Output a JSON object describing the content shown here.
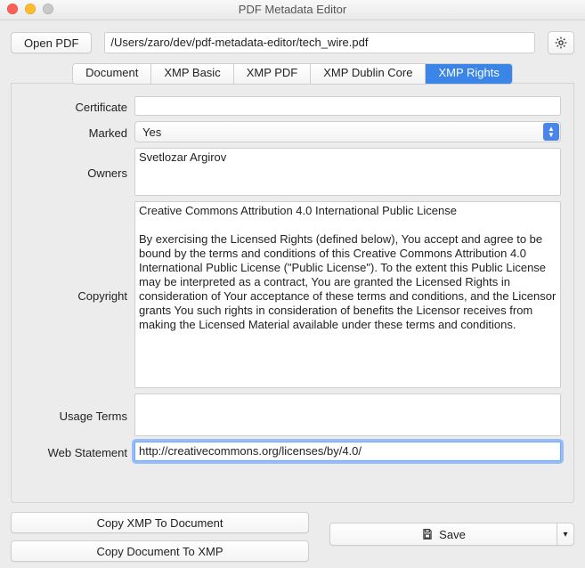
{
  "window": {
    "title": "PDF Metadata Editor"
  },
  "toolbar": {
    "open_label": "Open PDF",
    "file_path": "/Users/zaro/dev/pdf-metadata-editor/tech_wire.pdf"
  },
  "tabs": {
    "items": [
      {
        "label": "Document",
        "active": false
      },
      {
        "label": "XMP Basic",
        "active": false
      },
      {
        "label": "XMP PDF",
        "active": false
      },
      {
        "label": "XMP Dublin Core",
        "active": false
      },
      {
        "label": "XMP Rights",
        "active": true
      }
    ]
  },
  "form": {
    "labels": {
      "certificate": "Certificate",
      "marked": "Marked",
      "owners": "Owners",
      "copyright": "Copyright",
      "usage_terms": "Usage Terms",
      "web_statement": "Web Statement"
    },
    "values": {
      "certificate": "",
      "marked": "Yes",
      "owners": "Svetlozar Argirov",
      "copyright": "Creative Commons Attribution 4.0 International Public License\n\nBy exercising the Licensed Rights (defined below), You accept and agree to be bound by the terms and conditions of this Creative Commons Attribution 4.0 International Public License (\"Public License\"). To the extent this Public License may be interpreted as a contract, You are granted the Licensed Rights in consideration of Your acceptance of these terms and conditions, and the Licensor grants You such rights in consideration of benefits the Licensor receives from making the Licensed Material available under these terms and conditions.",
      "usage_terms": "",
      "web_statement": "http://creativecommons.org/licenses/by/4.0/"
    }
  },
  "footer": {
    "copy_xmp_to_doc_label": "Copy XMP To Document",
    "copy_doc_to_xmp_label": "Copy Document To XMP",
    "save_label": "Save"
  },
  "icons": {
    "gear": "gear-icon",
    "save": "save-icon",
    "dropdown": "chevron-down-icon"
  }
}
